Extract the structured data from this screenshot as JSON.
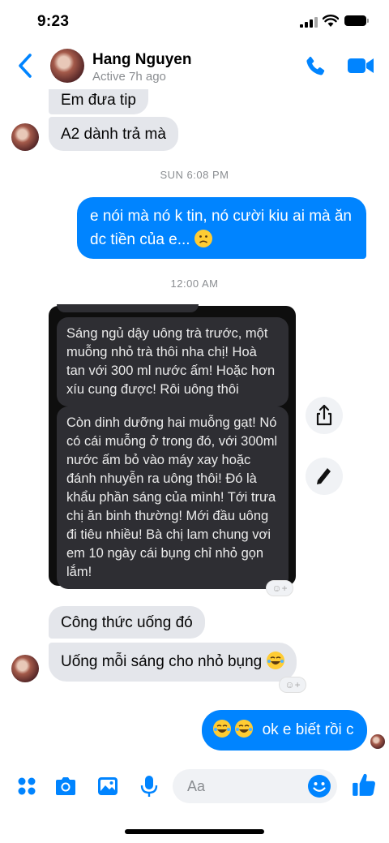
{
  "status_bar": {
    "time": "9:23"
  },
  "header": {
    "contact_name": "Hang Nguyen",
    "active_status": "Active 7h ago"
  },
  "messages": {
    "in_top_1": "Em đưa tip",
    "in_top_2": "A2 dành trả mà",
    "timestamp_1": "SUN 6:08 PM",
    "out_1_line1": "e nói mà nó k tin, nó cười kiu ai mà ăn",
    "out_1_line2": "dc tiền của e...",
    "timestamp_2": "12:00 AM",
    "dark_1": "Sáng ngủ dậy uông trà trước, một muỗng nhỏ trà thôi nha chị! Hoà tan với 300 ml nước ấm! Hoặc hơn xíu cung được! Rôi uông thôi",
    "dark_2": "Còn dinh dưỡng hai muỗng gạt! Nó có cái muỗng ở trong đó, với 300ml nước ấm bỏ vào máy xay hoặc đánh nhuyễn ra uông thôi! Đó là khẩu phần sáng của mình! Tới trưa  chị ăn binh thường! Mới đầu uông đi tiêu nhiều! Bà chị lam chung vơi em 10 ngày cái bụng chỉ nhỏ gọn lắm!",
    "in_mid_1": "Công thức uống đó",
    "in_mid_2": "Uống mỗi sáng cho nhỏ bụng",
    "out_2": "ok e biết rồi c"
  },
  "composer": {
    "placeholder": "Aa"
  },
  "colors": {
    "accent": "#0084ff",
    "incoming_bubble": "#e4e6eb",
    "dark_panel": "#0e0e0e"
  },
  "icons": [
    "back-chevron",
    "phone",
    "video-camera",
    "share",
    "pencil",
    "apps-grid",
    "camera",
    "gallery",
    "microphone",
    "emoji",
    "thumbs-up"
  ]
}
